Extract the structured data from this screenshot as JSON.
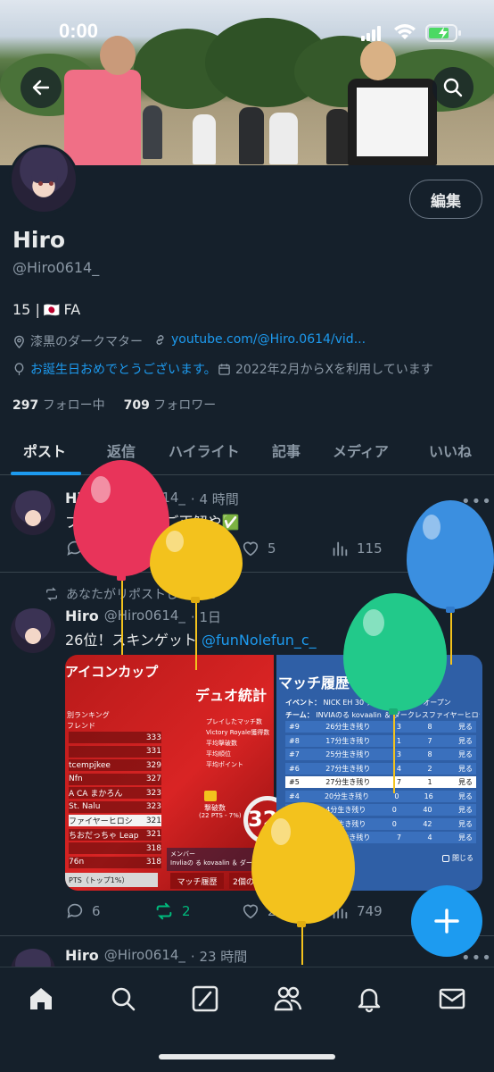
{
  "status_bar": {
    "time": "0:00"
  },
  "profile": {
    "name": "Hiro",
    "handle": "@Hiro0614_",
    "bio_prefix": "15 |",
    "bio_flag": "🇯🇵",
    "bio_suffix": "FA",
    "location": "漆黒のダークマター",
    "website": "youtube.com/@Hiro.0614/vid...",
    "birthday": "お誕生日おめでとうございます。",
    "joined": "2022年2月からXを利用しています",
    "following_count": "297",
    "following_label": "フォロー中",
    "followers_count": "709",
    "followers_label": "フォロワー",
    "edit_label": "編集"
  },
  "tabs": [
    {
      "label": "ポスト"
    },
    {
      "label": "返信"
    },
    {
      "label": "ハイライト"
    },
    {
      "label": "記事"
    },
    {
      "label": "メディア"
    },
    {
      "label": "いいね"
    }
  ],
  "posts": [
    {
      "name": "Hiro",
      "handle": "@Hiro0614_",
      "time": "· 4 時間",
      "text": "ブームー棒消！ご正解や✅",
      "replies": "",
      "reposts": "",
      "likes": "5",
      "views": "115"
    },
    {
      "repost_note": "あなたがリポストしました",
      "name": "Hiro",
      "handle": "@Hiro0614_",
      "time": "· 1日",
      "text": "26位！スキンゲット",
      "mention": "@funNolefun_c_",
      "replies": "6",
      "reposts": "2",
      "likes": "20",
      "views": "749",
      "media": {
        "left_title": "アイコンカップ",
        "left_subtitle": "デュオ統計",
        "left_labels": [
          "別ランキング",
          "フレンド"
        ],
        "ranking": [
          {
            "name": "",
            "score": "333"
          },
          {
            "name": "",
            "score": "331"
          },
          {
            "name": "tcempjkee",
            "score": "329"
          },
          {
            "name": "Nfn",
            "score": "327"
          },
          {
            "name": "A CA まかろん",
            "score": "323"
          },
          {
            "name": "St. Nalu",
            "score": "323"
          },
          {
            "name": "ファイヤーヒロシ",
            "score": "321"
          },
          {
            "name": "ちおだっちゃ Leap",
            "score": "321"
          },
          {
            "name": "",
            "score": "318"
          },
          {
            "name": "76n",
            "score": "318"
          }
        ],
        "left_footer": "PTS（トップ1%）",
        "stats": [
          "プレイしたマッチ数",
          "Victory Royale獲得数",
          "平均撃破数",
          "平均順位",
          "平均ポイント"
        ],
        "defeat_label": "撃破数",
        "defeat_sub": "(22 PTS - 7%)",
        "big_number": "32",
        "member_label": "メンバー",
        "member_names": "Invliaの る kovaalin ＆ ダークレスファイヤ",
        "bottom_tab_1": "マッチ履歴",
        "bottom_tab_2": "2個のプロ",
        "right_title": "マッチ履歴",
        "event_label": "イベント：",
        "event_value": "NICK EH 30 アイコンカップ　オープン",
        "team_label": "チーム：",
        "team_value": "INVIAのる kovaalin ＆ ダークレスファイヤーヒロシV2",
        "matches": [
          {
            "rank": "#9",
            "place": "26分生き残り",
            "elims": "3",
            "pts": "8",
            "action": "見る"
          },
          {
            "rank": "#8",
            "place": "17分生き残り",
            "elims": "1",
            "pts": "7",
            "action": "見る"
          },
          {
            "rank": "#7",
            "place": "25分生き残り",
            "elims": "3",
            "pts": "8",
            "action": "見る"
          },
          {
            "rank": "#6",
            "place": "27分生き残り",
            "elims": "4",
            "pts": "2",
            "action": "見る"
          },
          {
            "rank": "#5",
            "place": "27分生き残り",
            "elims": "7",
            "pts": "1",
            "action": "見る"
          },
          {
            "rank": "#4",
            "place": "20分生き残り",
            "elims": "0",
            "pts": "16",
            "action": "見る"
          },
          {
            "rank": "#3",
            "place": "4分生き残り",
            "elims": "0",
            "pts": "40",
            "action": "見る"
          },
          {
            "rank": "#2",
            "place": "9分生き残り",
            "elims": "0",
            "pts": "42",
            "action": "見る"
          },
          {
            "rank": "#1",
            "place": "24分生き残り",
            "elims": "7",
            "pts": "4",
            "action": "見る"
          }
        ],
        "close_label": "閉じる"
      }
    },
    {
      "name": "Hiro",
      "handle": "@Hiro0614_",
      "time": "· 23 時間"
    }
  ],
  "colors": {
    "background": "#15202b",
    "accent": "#1d9bf0",
    "repost_active": "#00ba7c",
    "balloon_red": "#e8345a",
    "balloon_yellow": "#f3c21d",
    "balloon_blue": "#3b8fe0",
    "balloon_green": "#22c98a"
  },
  "icons": {
    "back": "arrow-left-icon",
    "search": "search-icon",
    "location": "location-pin-icon",
    "link": "link-icon",
    "birthday": "balloon-icon",
    "calendar": "calendar-icon",
    "nav": [
      "home-icon",
      "search-icon",
      "grok-icon",
      "communities-icon",
      "bell-icon",
      "mail-icon"
    ]
  }
}
